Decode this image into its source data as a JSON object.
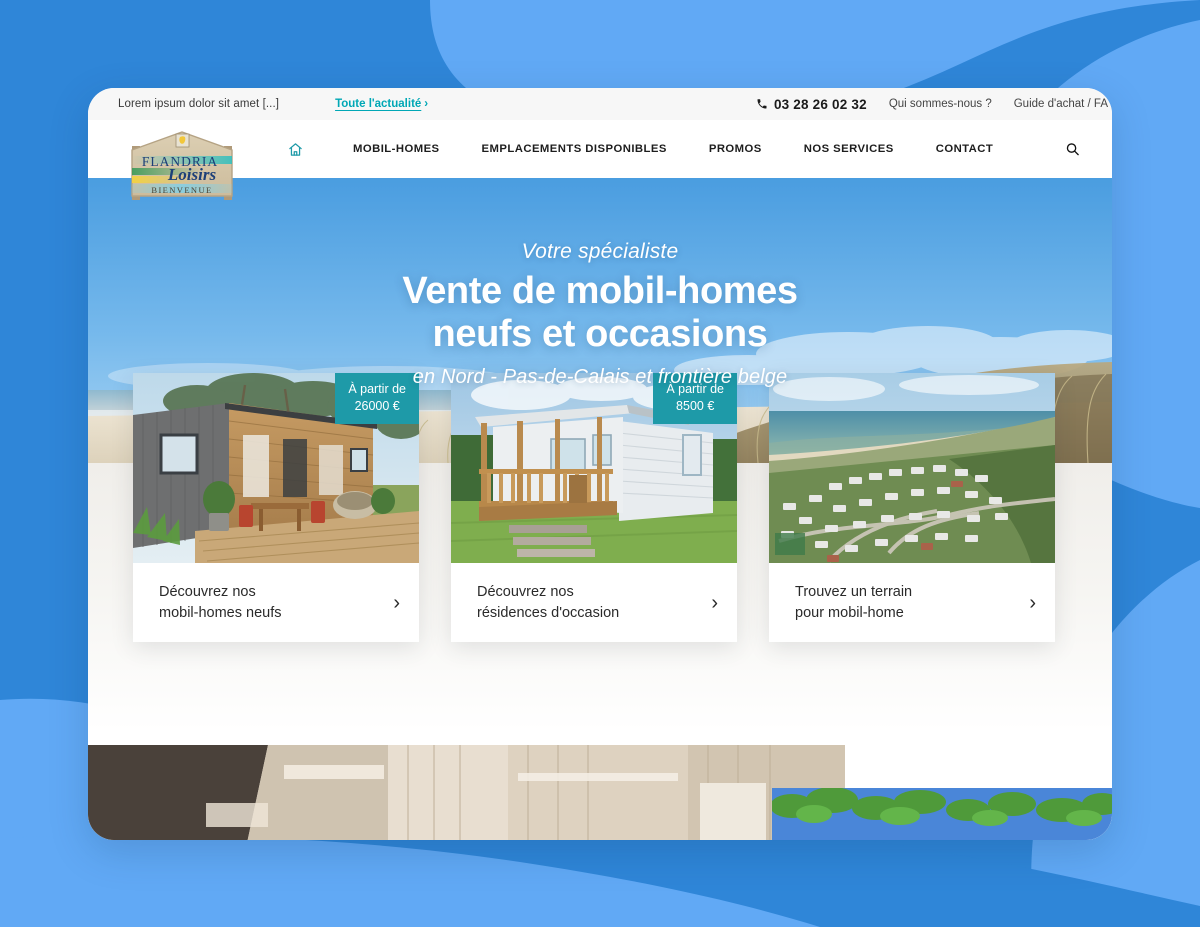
{
  "page": {
    "background_color": "#2f86d8",
    "background_color_light": "#61a9f5",
    "accent_teal": "#1e9aa8",
    "link_teal": "#00a7b5"
  },
  "topbar": {
    "ticker_text": "Lorem ipsum dolor sit amet [...]",
    "news_link": "Toute l'actualité",
    "news_chevron": "›",
    "phone_icon": "phone-icon",
    "phone": "03 28 26 02 32",
    "links": [
      {
        "label": "Qui sommes-nous ?"
      },
      {
        "label": "Guide d'achat / FA"
      }
    ]
  },
  "nav": {
    "home_icon": "home-icon",
    "search_icon": "search-icon",
    "items": [
      {
        "label": "MOBIL-HOMES"
      },
      {
        "label": "EMPLACEMENTS DISPONIBLES"
      },
      {
        "label": "PROMOS"
      },
      {
        "label": "NOS SERVICES"
      },
      {
        "label": "CONTACT"
      }
    ]
  },
  "logo": {
    "line1": "FLANDRIA",
    "line2": "Loisirs",
    "line3": "BIENVENUE",
    "crest_icon": "lion-crest-icon"
  },
  "hero": {
    "kicker": "Votre spécialiste",
    "title_line1": "Vente de mobil-homes",
    "title_line2": "neufs et occasions",
    "subtitle": "en Nord  -  Pas-de-Calais et frontière belge",
    "image_alt": "beach-dunes-photo"
  },
  "cards": [
    {
      "image_alt": "modern-mobil-home-terrace-photo",
      "badge_label": "À partir de",
      "badge_price": "26000 €",
      "text_line1": "Découvrez nos",
      "text_line2": "mobil-homes neufs",
      "arrow": "›"
    },
    {
      "image_alt": "used-mobil-home-deck-photo",
      "badge_label": "À partir de",
      "badge_price": "8500 €",
      "text_line1": "Découvrez nos",
      "text_line2": "résidences d'occasion",
      "arrow": "›"
    },
    {
      "image_alt": "aerial-campsite-seaside-photo",
      "badge_label": "",
      "badge_price": "",
      "text_line1": "Trouvez un terrain",
      "text_line2": "pour mobil-home",
      "arrow": "›"
    }
  ],
  "next_section": {
    "interior_alt": "mobil-home-interior-photo",
    "greenery_alt": "greenery-photo"
  }
}
